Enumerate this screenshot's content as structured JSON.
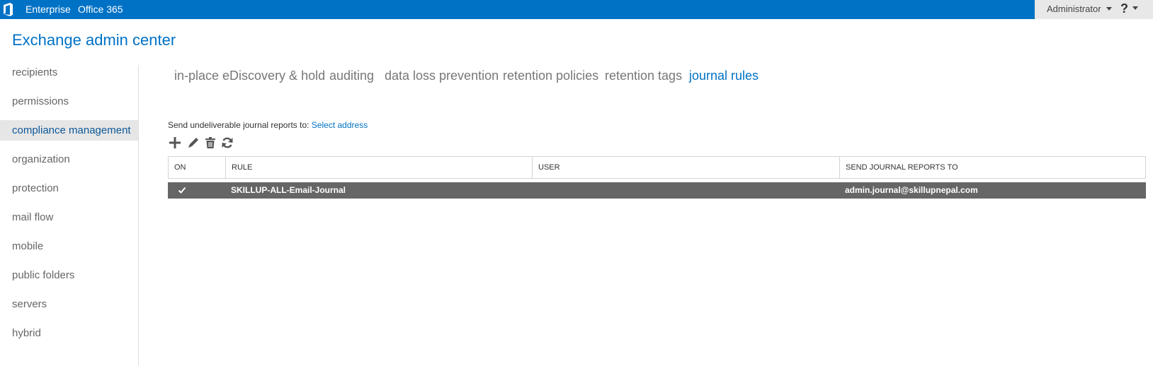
{
  "topbar": {
    "logo_icon": "office-logo-icon",
    "links": [
      "Enterprise",
      "Office 365"
    ],
    "user_label": "Administrator",
    "help_label": "?",
    "bar_color": "#0072c6"
  },
  "app": {
    "title": "Exchange admin center"
  },
  "leftnav": {
    "items": [
      {
        "label": "recipients"
      },
      {
        "label": "permissions"
      },
      {
        "label": "compliance management",
        "selected": true
      },
      {
        "label": "organization"
      },
      {
        "label": "protection"
      },
      {
        "label": "mail flow"
      },
      {
        "label": "mobile"
      },
      {
        "label": "public folders"
      },
      {
        "label": "servers"
      },
      {
        "label": "hybrid"
      }
    ]
  },
  "tabs": [
    {
      "label": "in-place eDiscovery & hold"
    },
    {
      "label": "auditing"
    },
    {
      "label": "data loss prevention"
    },
    {
      "label": "retention policies"
    },
    {
      "label": "retention tags"
    },
    {
      "label": "journal rules",
      "active": true
    }
  ],
  "journal": {
    "undeliverable_prefix": "Send undeliverable journal reports to:",
    "undeliverable_link": "Select address"
  },
  "toolbar": {
    "icons": [
      "add-icon",
      "edit-icon",
      "delete-icon",
      "refresh-icon"
    ]
  },
  "grid": {
    "columns": [
      "ON",
      "RULE",
      "USER",
      "SEND JOURNAL REPORTS TO"
    ],
    "rows": [
      {
        "on": true,
        "rule": "SKILLUP-ALL-Email-Journal",
        "user": "",
        "send_to": "admin.journal@skillupnepal.com"
      }
    ],
    "selected_row_color": "#666666"
  }
}
